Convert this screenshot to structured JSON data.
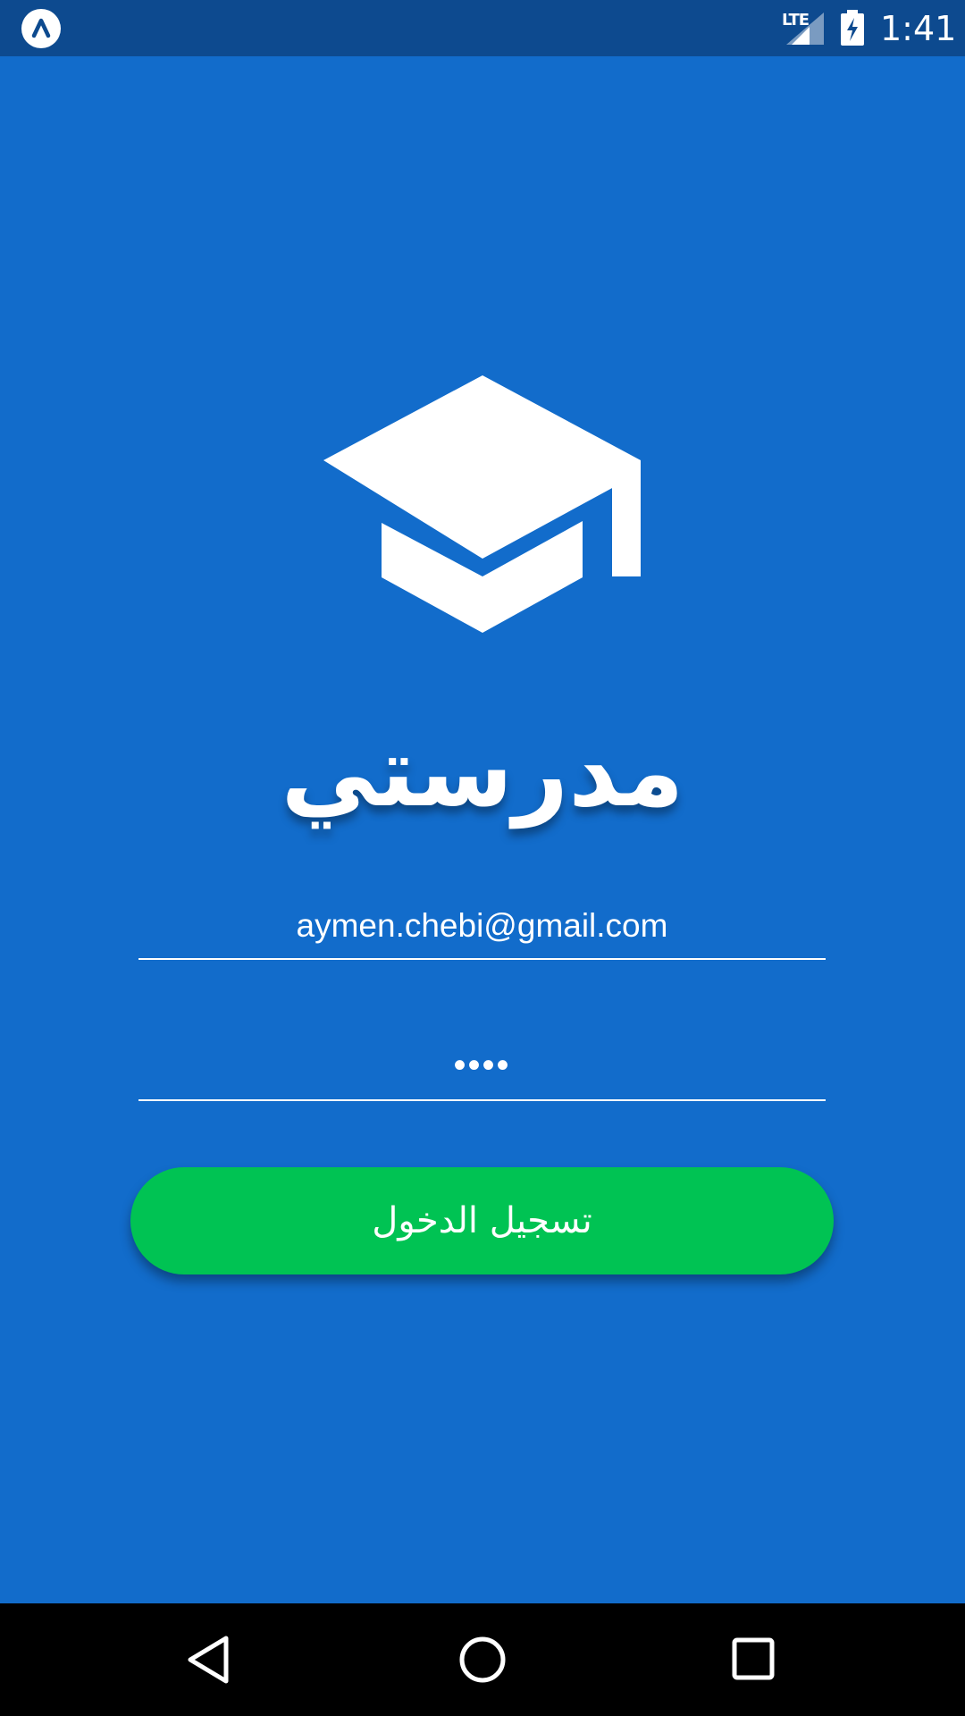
{
  "status_bar": {
    "app_icon": "expo-icon",
    "network_label": "LTE",
    "signal_icon": "signal-icon",
    "battery_icon": "battery-charging-icon",
    "time": "1:41",
    "background_color": "#0d4a8f"
  },
  "login": {
    "logo_icon": "graduation-cap-icon",
    "app_name": "مدرستي",
    "email_value": "aymen.chebi@gmail.com",
    "password_value": "••••",
    "login_button_label": "تسجيل الدخول"
  },
  "nav_bar": {
    "back_icon": "back-triangle-icon",
    "home_icon": "home-circle-icon",
    "recents_icon": "recents-square-icon"
  },
  "colors": {
    "background": "#126ccb",
    "button": "#00c353",
    "text": "#ffffff"
  }
}
